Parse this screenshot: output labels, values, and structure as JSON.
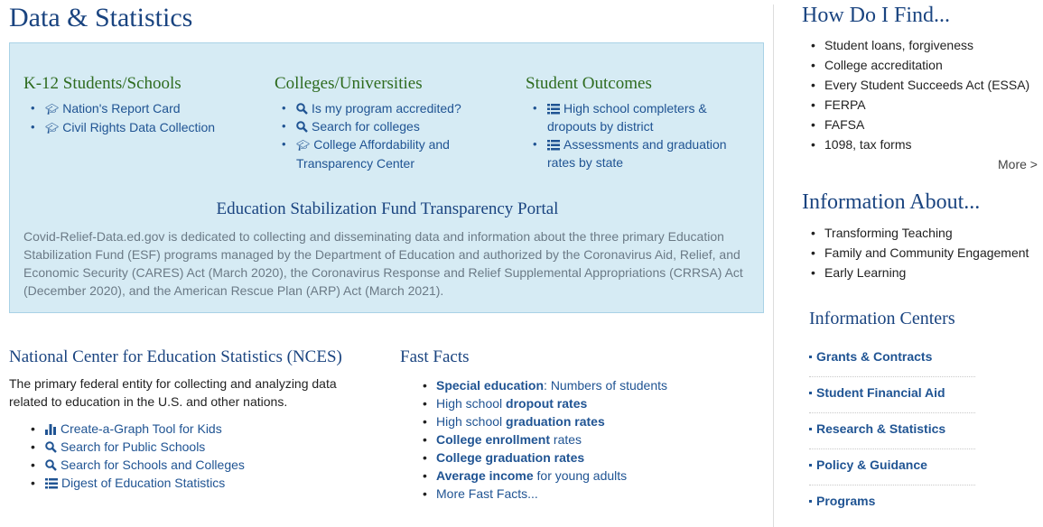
{
  "page": {
    "title": "Data & Statistics"
  },
  "box": {
    "columns": [
      {
        "title": "K-12 Students/Schools",
        "links": [
          {
            "icon": "graduation-cap-icon",
            "label": "Nation's Report Card"
          },
          {
            "icon": "graduation-cap-icon",
            "label": "Civil Rights Data Collection"
          }
        ]
      },
      {
        "title": "Colleges/Universities",
        "links": [
          {
            "icon": "search-icon",
            "label": "Is my program accredited?"
          },
          {
            "icon": "search-icon",
            "label": "Search for colleges"
          },
          {
            "icon": "graduation-cap-icon",
            "label": "College Affordability and Transparency Center"
          }
        ]
      },
      {
        "title": "Student Outcomes",
        "links": [
          {
            "icon": "list-icon",
            "label": "High school completers & dropouts by district"
          },
          {
            "icon": "list-icon",
            "label": "Assessments and graduation rates by state"
          }
        ]
      }
    ],
    "esf_title": "Education Stabilization Fund Transparency Portal",
    "esf_text": "Covid-Relief-Data.ed.gov is dedicated to collecting and disseminating data and information about the three primary Education Stabilization Fund (ESF) programs managed by the Department of Education and authorized by the Coronavirus Aid, Relief, and Economic Security (CARES) Act (March 2020), the Coronavirus Response and Relief Supplemental Appropriations (CRRSA) Act (December 2020), and the American Rescue Plan (ARP) Act (March 2021)."
  },
  "nces": {
    "title": "National Center for Education Statistics (NCES)",
    "description": "The primary federal entity for collecting and analyzing data related to education in the U.S. and other nations.",
    "links": [
      {
        "icon": "bar-chart-icon",
        "label": "Create-a-Graph Tool for Kids"
      },
      {
        "icon": "search-icon",
        "label": "Search for Public Schools"
      },
      {
        "icon": "search-icon",
        "label": "Search for Schools and Colleges"
      },
      {
        "icon": "list-icon",
        "label": "Digest of Education Statistics"
      }
    ]
  },
  "fast_facts": {
    "title": "Fast Facts",
    "items": [
      {
        "pre": "",
        "bold": "Special education",
        "post": ": Numbers of students"
      },
      {
        "pre": "High school ",
        "bold": "dropout rates",
        "post": ""
      },
      {
        "pre": "High school ",
        "bold": "graduation rates",
        "post": ""
      },
      {
        "pre": "",
        "bold": "College enrollment",
        "post": " rates"
      },
      {
        "pre": "",
        "bold": "College graduation rates",
        "post": ""
      },
      {
        "pre": "",
        "bold": "Average income",
        "post": " for young adults"
      },
      {
        "pre": "More Fast Facts...",
        "bold": "",
        "post": ""
      }
    ]
  },
  "sidebar": {
    "how_title": "How Do I Find...",
    "how_items": [
      "Student loans, forgiveness",
      "College accreditation",
      "Every Student Succeeds Act (ESSA)",
      "FERPA",
      "FAFSA",
      "1098, tax forms"
    ],
    "more_label": "More >",
    "info_title": "Information About...",
    "info_items": [
      "Transforming Teaching",
      "Family and Community Engagement",
      "Early Learning"
    ],
    "centers_title": "Information Centers",
    "centers": [
      "Grants & Contracts",
      "Student Financial Aid",
      "Research & Statistics",
      "Policy & Guidance",
      "Programs"
    ]
  }
}
